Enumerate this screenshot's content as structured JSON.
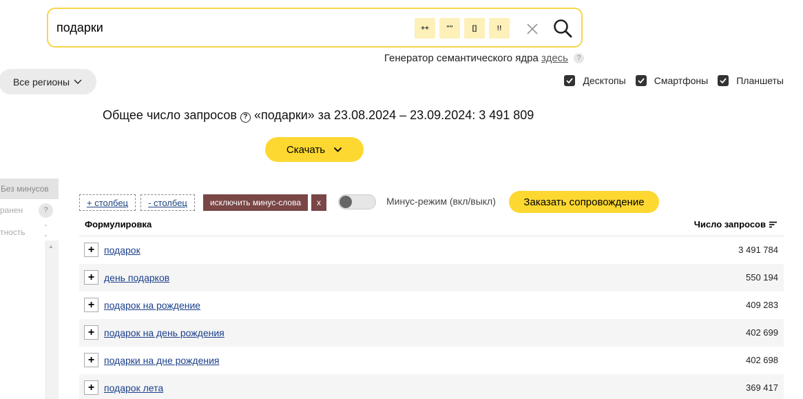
{
  "search": {
    "query": "подарки",
    "operators": [
      "++",
      "\"\"",
      "[]",
      "!!"
    ]
  },
  "semantic_core": {
    "text": "Генератор семантического ядра",
    "link": "здесь",
    "help": "?"
  },
  "region": {
    "label": "Все регионы"
  },
  "devices": [
    {
      "label": "Десктопы",
      "checked": true
    },
    {
      "label": "Смартфоны",
      "checked": true
    },
    {
      "label": "Планшеты",
      "checked": true
    }
  ],
  "summary": {
    "prefix": "Общее число запросов",
    "suffix": "«подарки» за 23.08.2024 – 23.09.2024: 3 491 809"
  },
  "download": {
    "label": "Скачать"
  },
  "left_panel": {
    "top": "Без минусов",
    "row1": "ранен",
    "row1_help": "?",
    "row2": "тность"
  },
  "toolbar": {
    "add_column": "+ столбец",
    "remove_column": "- столбец",
    "exclude": "исключить минус-слова",
    "exclude_close": "x",
    "minus_mode": "Минус-режим (вкл/выкл)",
    "order": "Заказать сопровождение"
  },
  "table": {
    "col_phrase": "Формулировка",
    "col_count": "Число запросов",
    "rows": [
      {
        "phrase": "подарок",
        "count": "3 491 784"
      },
      {
        "phrase": "день подарков",
        "count": "550 194"
      },
      {
        "phrase": "подарок на рождение",
        "count": "409 283"
      },
      {
        "phrase": "подарок на день рождения",
        "count": "402 699"
      },
      {
        "phrase": "подарки на дне рождения",
        "count": "402 698"
      },
      {
        "phrase": "подарок лета",
        "count": "369 417"
      }
    ]
  },
  "colors": {
    "accent_yellow": "#fdd831",
    "search_border": "#f7d548",
    "exclude_bg": "#7a4646",
    "link_blue": "#1a3f8a"
  }
}
